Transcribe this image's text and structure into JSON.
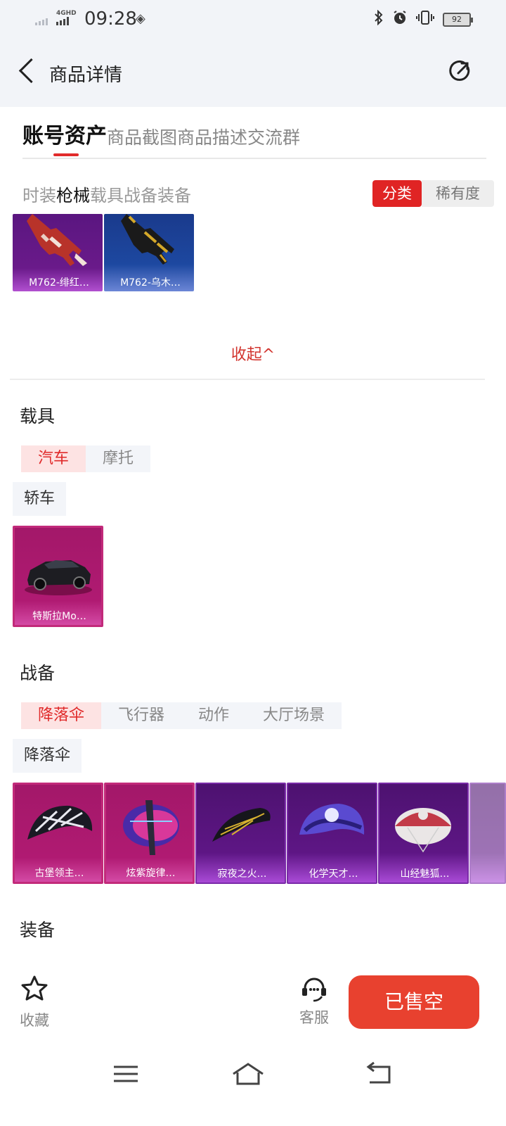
{
  "status_bar": {
    "network": "4GHD",
    "time": "09:28",
    "battery": "92"
  },
  "header": {
    "title": "商品详情"
  },
  "tabs": [
    {
      "label": "账号资产"
    },
    {
      "label": "商品截图"
    },
    {
      "label": "商品描述"
    },
    {
      "label": "交流群"
    }
  ],
  "categories": [
    {
      "label": "时装"
    },
    {
      "label": "枪械"
    },
    {
      "label": "载具"
    },
    {
      "label": "战备"
    },
    {
      "label": "装备"
    }
  ],
  "sort_toggle": {
    "category": "分类",
    "rarity": "稀有度"
  },
  "weapons": [
    {
      "name": "M762-绯红…"
    },
    {
      "name": "M762-乌木…"
    }
  ],
  "collapse_label": "收起^",
  "vehicles": {
    "title": "载具",
    "chips": [
      {
        "label": "汽车"
      },
      {
        "label": "摩托"
      }
    ],
    "subcategory": "轿车",
    "items": [
      {
        "name": "特斯拉Mo…"
      }
    ]
  },
  "gear": {
    "title": "战备",
    "chips": [
      {
        "label": "降落伞"
      },
      {
        "label": "飞行器"
      },
      {
        "label": "动作"
      },
      {
        "label": "大厅场景"
      }
    ],
    "subcategory": "降落伞",
    "items": [
      {
        "name": "古堡领主…"
      },
      {
        "name": "炫紫旋律…"
      },
      {
        "name": "寂夜之火…"
      },
      {
        "name": "化学天才…"
      },
      {
        "name": "山经魅狐…"
      }
    ]
  },
  "equipment": {
    "title": "装备"
  },
  "bottom_bar": {
    "favorite": "收藏",
    "customer_service": "客服",
    "sold_out": "已售空"
  },
  "colors": {
    "accent": "#e02424",
    "sold_out_button": "#e8412f"
  }
}
